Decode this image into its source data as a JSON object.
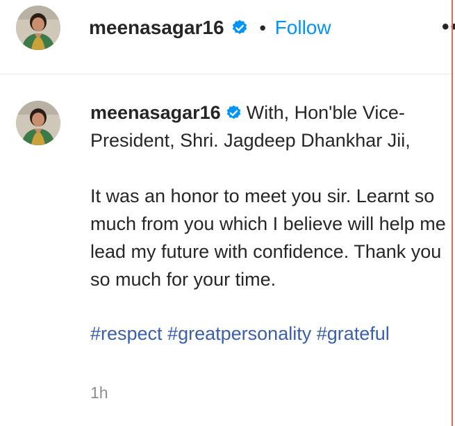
{
  "header": {
    "username": "meenasagar16",
    "separator": "•",
    "follow_label": "Follow",
    "more_label": "••"
  },
  "post": {
    "username": "meenasagar16",
    "caption_line1": "With, Hon'ble Vice-President, Shri. Jagdeep Dhankhar Jii,",
    "caption_body": "It was an honor to meet you sir. Learnt so much from you which I believe will help me lead my future with confidence. Thank you so much for your time.",
    "hashtags": [
      "#respect",
      "#greatpersonality",
      "#grateful"
    ],
    "timestamp": "1h"
  },
  "colors": {
    "follow": "#0095f6",
    "hashtag": "#3a5fb0",
    "verified": "#0095f6",
    "timestamp": "#8e8e8e",
    "edge": "#e06b52"
  },
  "icons": {
    "verified": "verified-badge-icon",
    "more": "more-options-icon"
  }
}
